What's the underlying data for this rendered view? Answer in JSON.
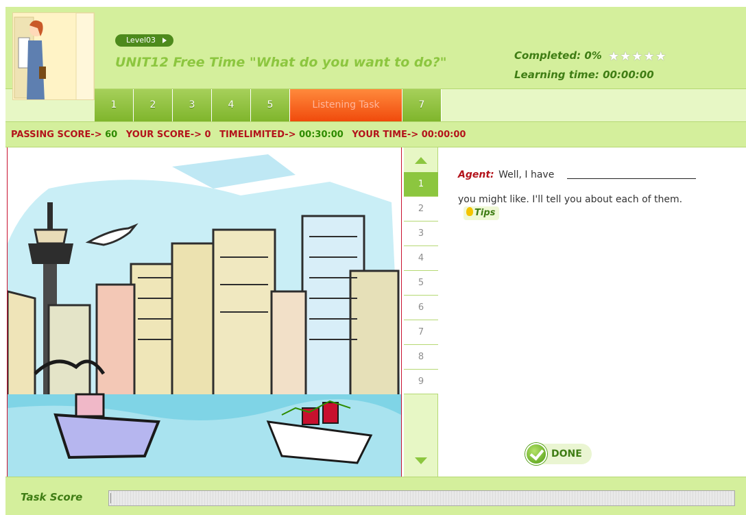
{
  "header": {
    "level": "Level03",
    "unit_title": "UNIT12  Free Time \"What do you want to do?\"",
    "completed_label": "Completed:",
    "completed_value": "0%",
    "stars_filled": 0,
    "stars_total": 5,
    "learning_time_label": "Learning time:",
    "learning_time_value": "00:00:00"
  },
  "tabs": [
    {
      "label": "1",
      "active": false
    },
    {
      "label": "2",
      "active": false
    },
    {
      "label": "3",
      "active": false
    },
    {
      "label": "4",
      "active": false
    },
    {
      "label": "5",
      "active": false
    },
    {
      "label": "Listening Task",
      "active": true
    },
    {
      "label": "7",
      "active": false
    }
  ],
  "scoreline": {
    "passing_label": "PASSING SCORE->",
    "passing_value": "60",
    "your_score_label": "YOUR SCORE->",
    "your_score_value": "0",
    "timelimited_label": "TIMELIMITED->",
    "timelimited_value": "00:30:00",
    "your_time_label": "YOUR TIME->",
    "your_time_value": "00:00:00"
  },
  "questions": {
    "items": [
      "1",
      "2",
      "3",
      "4",
      "5",
      "6",
      "7",
      "8",
      "9"
    ],
    "active": "1"
  },
  "qa": {
    "speaker": "Agent:",
    "text_before": "Well, I have",
    "text_after": "you might like. I'll tell you about each of them.",
    "blank_value": "",
    "tips_label": "Tips",
    "done_label": "DONE"
  },
  "footer": {
    "task_score_label": "Task Score",
    "task_score_progress": 0
  },
  "colors": {
    "header_bg": "#d4ef9c",
    "accent_green": "#8cc63f",
    "dark_green": "#3f7d14",
    "active_tab": "#f04a0c",
    "score_red": "#b3131b"
  }
}
